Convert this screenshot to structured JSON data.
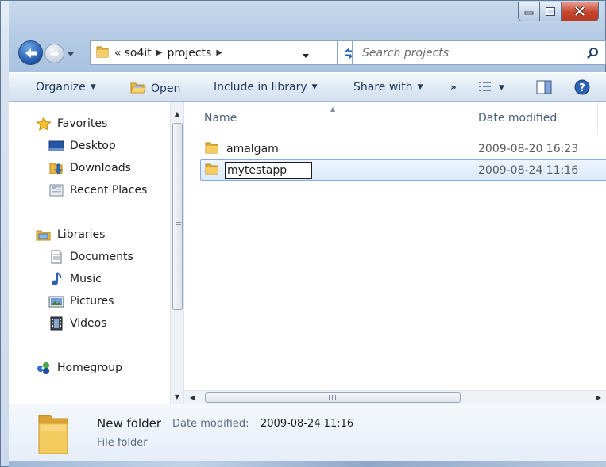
{
  "window": {
    "caption_buttons": [
      "minimize-icon",
      "maximize-icon",
      "close-icon"
    ]
  },
  "navigation": {
    "breadcrumb_overflow": "«",
    "breadcrumb": [
      "so4it",
      "projects"
    ],
    "search_placeholder": "Search projects"
  },
  "toolbar": {
    "organize": "Organize",
    "open": "Open",
    "include_in_library": "Include in library",
    "share_with": "Share with",
    "more": "»"
  },
  "nav_pane": {
    "favorites": {
      "label": "Favorites",
      "items": [
        "Desktop",
        "Downloads",
        "Recent Places"
      ]
    },
    "libraries": {
      "label": "Libraries",
      "items": [
        "Documents",
        "Music",
        "Pictures",
        "Videos"
      ]
    },
    "homegroup": "Homegroup"
  },
  "file_list": {
    "columns": [
      "Name",
      "Date modified"
    ],
    "rows": [
      {
        "name": "amalgam",
        "date_modified": "2009-08-20 16:23"
      },
      {
        "name": "mytestapp",
        "date_modified": "2009-08-24 11:16",
        "selected": true,
        "renaming": true
      }
    ]
  },
  "details_pane": {
    "name": "New folder",
    "date_label": "Date modified:",
    "date_value": "2009-08-24 11:16",
    "type": "File folder"
  },
  "colors": {
    "selection_border": "#84acdd",
    "command_text": "#1e395b",
    "close_button": "#c5452c"
  }
}
